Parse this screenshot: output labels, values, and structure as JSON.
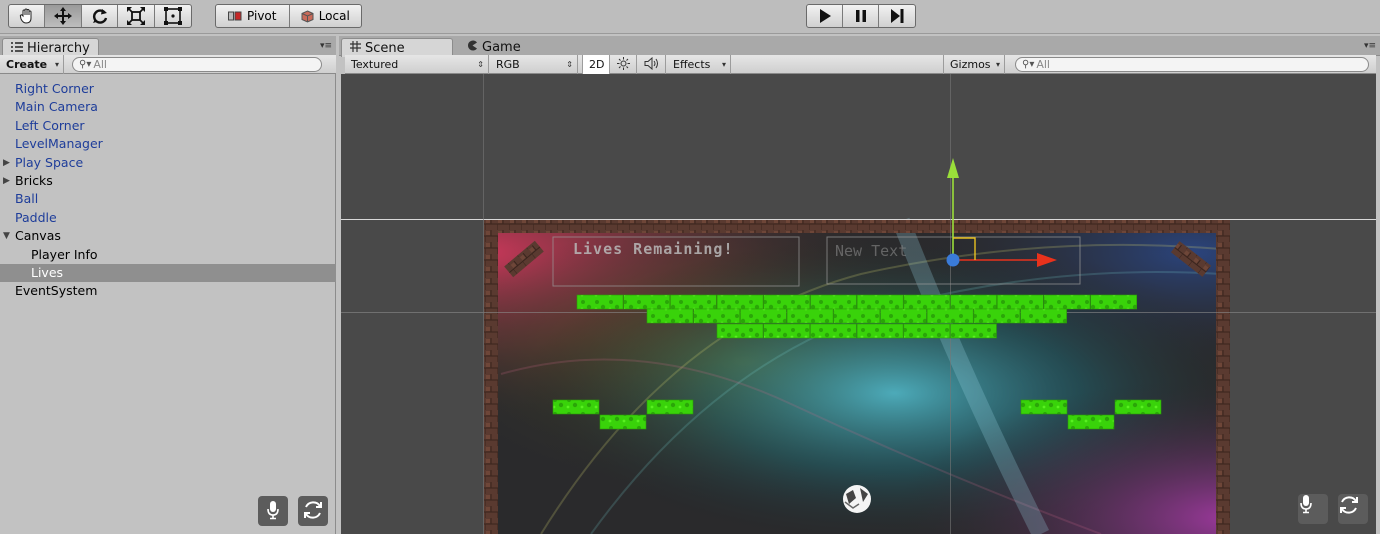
{
  "toolbar": {
    "tools": [
      "hand-tool",
      "move-tool",
      "rotate-tool",
      "scale-tool",
      "rect-tool"
    ],
    "active_tool": "move-tool",
    "pivot_label": "Pivot",
    "local_label": "Local",
    "play_controls": [
      "play",
      "pause",
      "step"
    ]
  },
  "hierarchy": {
    "tab_label": "Hierarchy",
    "create_label": "Create",
    "search_placeholder": "All",
    "items": [
      {
        "label": "Right Corner",
        "blue": true
      },
      {
        "label": "Main Camera",
        "blue": true
      },
      {
        "label": "Left Corner",
        "blue": true
      },
      {
        "label": "LevelManager",
        "blue": true
      },
      {
        "label": "Play Space",
        "blue": true,
        "fold": "collapsed"
      },
      {
        "label": "Bricks",
        "blue": false,
        "fold": "collapsed"
      },
      {
        "label": "Ball",
        "blue": true
      },
      {
        "label": "Paddle",
        "blue": true
      },
      {
        "label": "Canvas",
        "blue": false,
        "fold": "expanded"
      },
      {
        "label": "Player Info",
        "blue": false,
        "child": true
      },
      {
        "label": "Lives",
        "blue": false,
        "child": true,
        "selected": true
      },
      {
        "label": "EventSystem",
        "blue": false
      }
    ]
  },
  "scene": {
    "tabs": [
      {
        "label": "Scene",
        "active": true,
        "icon": "grid-icon"
      },
      {
        "label": "Game",
        "active": false,
        "icon": "pacman-icon"
      }
    ],
    "shading_mode": "Textured",
    "render_mode": "RGB",
    "mode_2d_label": "2D",
    "effects_label": "Effects",
    "gizmos_label": "Gizmos",
    "search_placeholder": "All",
    "lives_text": "Lives Remaining!",
    "new_text": "New Text"
  },
  "colors": {
    "brick_green": "#3fe00a",
    "gizmo_y": "#9adf3a",
    "gizmo_x": "#e8321c",
    "hierarchy_blue": "#1e3d9a",
    "selection": "#8f8f8f"
  }
}
